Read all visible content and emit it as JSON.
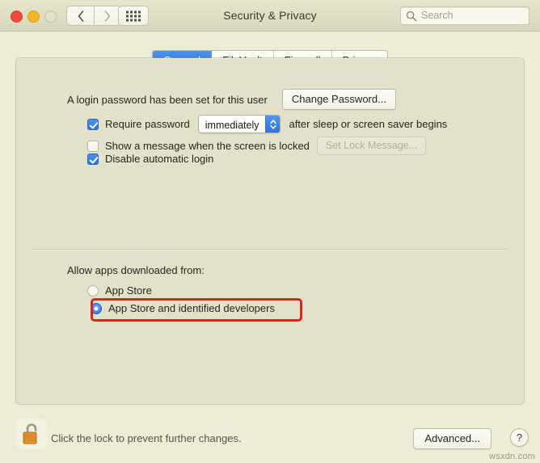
{
  "window": {
    "title": "Security & Privacy",
    "traffic_lights": [
      {
        "name": "close",
        "color": "#f0493e"
      },
      {
        "name": "minimize",
        "color": "#f5b726"
      },
      {
        "name": "zoom",
        "color": "#e2e2cd"
      }
    ],
    "nav": {
      "back": "back-chevron",
      "forward": "forward-chevron"
    },
    "show_all": "grid-icon",
    "search": {
      "placeholder": "Search",
      "value": "",
      "icon": "search-icon"
    }
  },
  "tabs": [
    {
      "label": "General",
      "selected": true
    },
    {
      "label": "FileVault",
      "selected": false
    },
    {
      "label": "Firewall",
      "selected": false
    },
    {
      "label": "Privacy",
      "selected": false
    }
  ],
  "general": {
    "login_password_text": "A login password has been set for this user",
    "change_password_button": "Change Password...",
    "require_password": {
      "checked": true,
      "label": "Require password",
      "popup_value": "immediately",
      "suffix": "after sleep or screen saver begins"
    },
    "show_message": {
      "checked": false,
      "label": "Show a message when the screen is locked",
      "button": "Set Lock Message...",
      "button_disabled": true
    },
    "disable_auto_login": {
      "checked": true,
      "label": "Disable automatic login"
    },
    "allow_apps_label": "Allow apps downloaded from:",
    "allow_options": [
      {
        "label": "App Store",
        "selected": false
      },
      {
        "label": "App Store and identified developers",
        "selected": true
      }
    ],
    "highlight_color": "#e81e1e"
  },
  "footer": {
    "lock_icon": "unlocked-padlock-icon",
    "lock_text": "Click the lock to prevent further changes.",
    "advanced_button": "Advanced...",
    "help_button": "?"
  },
  "watermark": "wsxdn.com"
}
